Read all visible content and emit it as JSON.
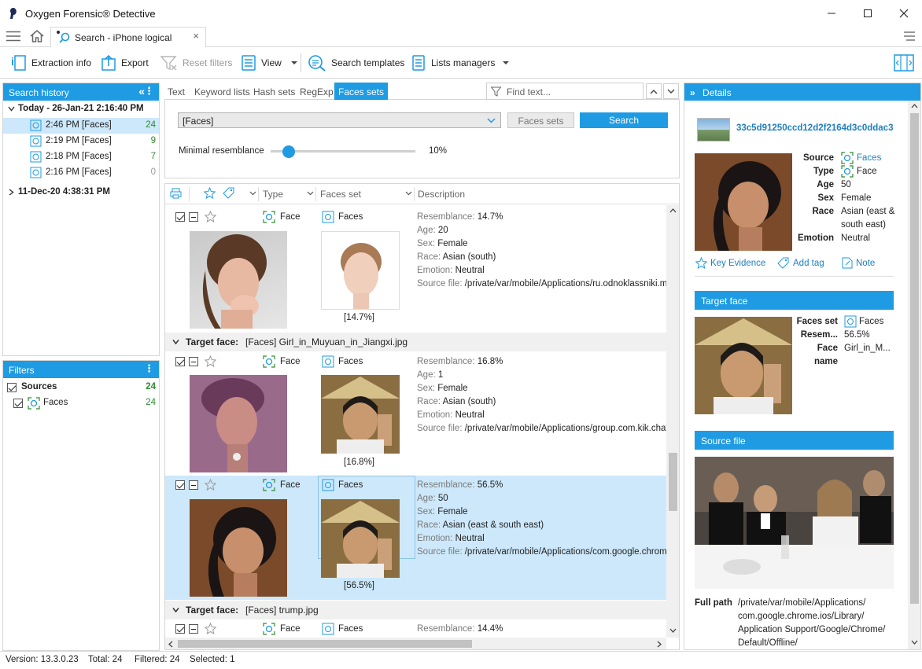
{
  "window": {
    "title": "Oxygen Forensic® Detective",
    "tab_title": "Search - iPhone logical"
  },
  "toolbar": {
    "extraction_info": "Extraction info",
    "export": "Export",
    "reset_filters": "Reset filters",
    "view": "View",
    "search_templates": "Search templates",
    "lists_managers": "Lists managers"
  },
  "search_history": {
    "title": "Search history",
    "today_group": "Today - 26-Jan-21 2:16:40 PM",
    "items": [
      {
        "time": "2:46 PM",
        "label": "[Faces]",
        "count": "24"
      },
      {
        "time": "2:19 PM",
        "label": "[Faces]",
        "count": "9"
      },
      {
        "time": "2:18 PM",
        "label": "[Faces]",
        "count": "7"
      },
      {
        "time": "2:16 PM",
        "label": "[Faces]",
        "count": "0"
      }
    ],
    "older_group": "11-Dec-20 4:38:31 PM"
  },
  "filters": {
    "title": "Filters",
    "sources_label": "Sources",
    "sources_count": "24",
    "faces_label": "Faces",
    "faces_count": "24"
  },
  "search_tabs": [
    "Text",
    "Keyword lists",
    "Hash sets",
    "RegExp",
    "Faces sets"
  ],
  "find_placeholder": "Find text...",
  "search_panel": {
    "selected_set": "[Faces]",
    "faces_sets_button": "Faces sets",
    "search_button": "Search",
    "minimal_resemblance_label": "Minimal resemblance",
    "minimal_resemblance_value": "10%",
    "minimal_resemblance_fraction": 0.1
  },
  "grid": {
    "columns": {
      "type": "Type",
      "faces_set": "Faces set",
      "description": "Description"
    },
    "rows": [
      {
        "type": "Face",
        "set": "Faces",
        "match": "[14.7%]",
        "resemblance": "14.7%",
        "age": "20",
        "sex": "Female",
        "race": "Asian (south)",
        "emotion": "Neutral",
        "source": "/private/var/mobile/Applications/ru.odnoklassniki.mess"
      },
      {
        "type": "Face",
        "set": "Faces",
        "match": "[16.8%]",
        "resemblance": "16.8%",
        "age": "1",
        "sex": "Female",
        "race": "Asian (south)",
        "emotion": "Neutral",
        "source": "/private/var/mobile/Applications/group.com.kik.chat/c"
      },
      {
        "type": "Face",
        "set": "Faces",
        "match": "[56.5%]",
        "resemblance": "56.5%",
        "age": "50",
        "sex": "Female",
        "race": "Asian (east & south east)",
        "emotion": "Neutral",
        "source": "/private/var/mobile/Applications/com.google.chrome.io"
      },
      {
        "type": "Face",
        "set": "Faces",
        "resemblance": "14.4%"
      }
    ],
    "groups": [
      {
        "prefix": "Target face:",
        "value": "[Faces] Girl_in_Muyuan_in_Jiangxi.jpg"
      },
      {
        "prefix": "Target face:",
        "value": "[Faces] trump.jpg"
      }
    ],
    "labels": {
      "resemblance": "Resemblance:",
      "age": "Age:",
      "sex": "Sex:",
      "race": "Race:",
      "emotion": "Emotion:",
      "source_file": "Source file:"
    }
  },
  "details": {
    "title": "Details",
    "hash": "33c5d91250ccd12d2f2164d3c0ddac3",
    "source_label": "Source",
    "source_value": "Faces",
    "type_label": "Type",
    "type_value": "Face",
    "age_label": "Age",
    "age_value": "50",
    "sex_label": "Sex",
    "sex_value": "Female",
    "race_label": "Race",
    "race_value_1": "Asian (east &",
    "race_value_2": "south east)",
    "emotion_label": "Emotion",
    "emotion_value": "Neutral",
    "key_evidence": "Key Evidence",
    "add_tag": "Add tag",
    "note": "Note",
    "target_face_title": "Target face",
    "faces_set_label": "Faces set",
    "faces_set_value": "Faces",
    "resem_label": "Resem...",
    "resem_value": "56.5%",
    "face_name_label_1": "Face",
    "face_name_label_2": "name",
    "face_name_value": "Girl_in_M...",
    "source_file_title": "Source file",
    "full_path_label": "Full path",
    "full_path_lines": [
      "/private/var/mobile/Applications/",
      "com.google.chrome.ios/Library/",
      "Application Support/Google/Chrome/",
      "Default/Offline/"
    ]
  },
  "status": {
    "version": "Version: 13.3.0.23",
    "total": "Total: 24",
    "filtered": "Filtered: 24",
    "selected": "Selected: 1"
  },
  "colors": {
    "accent": "#1e9be3",
    "selection": "#cde8fb",
    "count_green": "#2e8b2e"
  }
}
